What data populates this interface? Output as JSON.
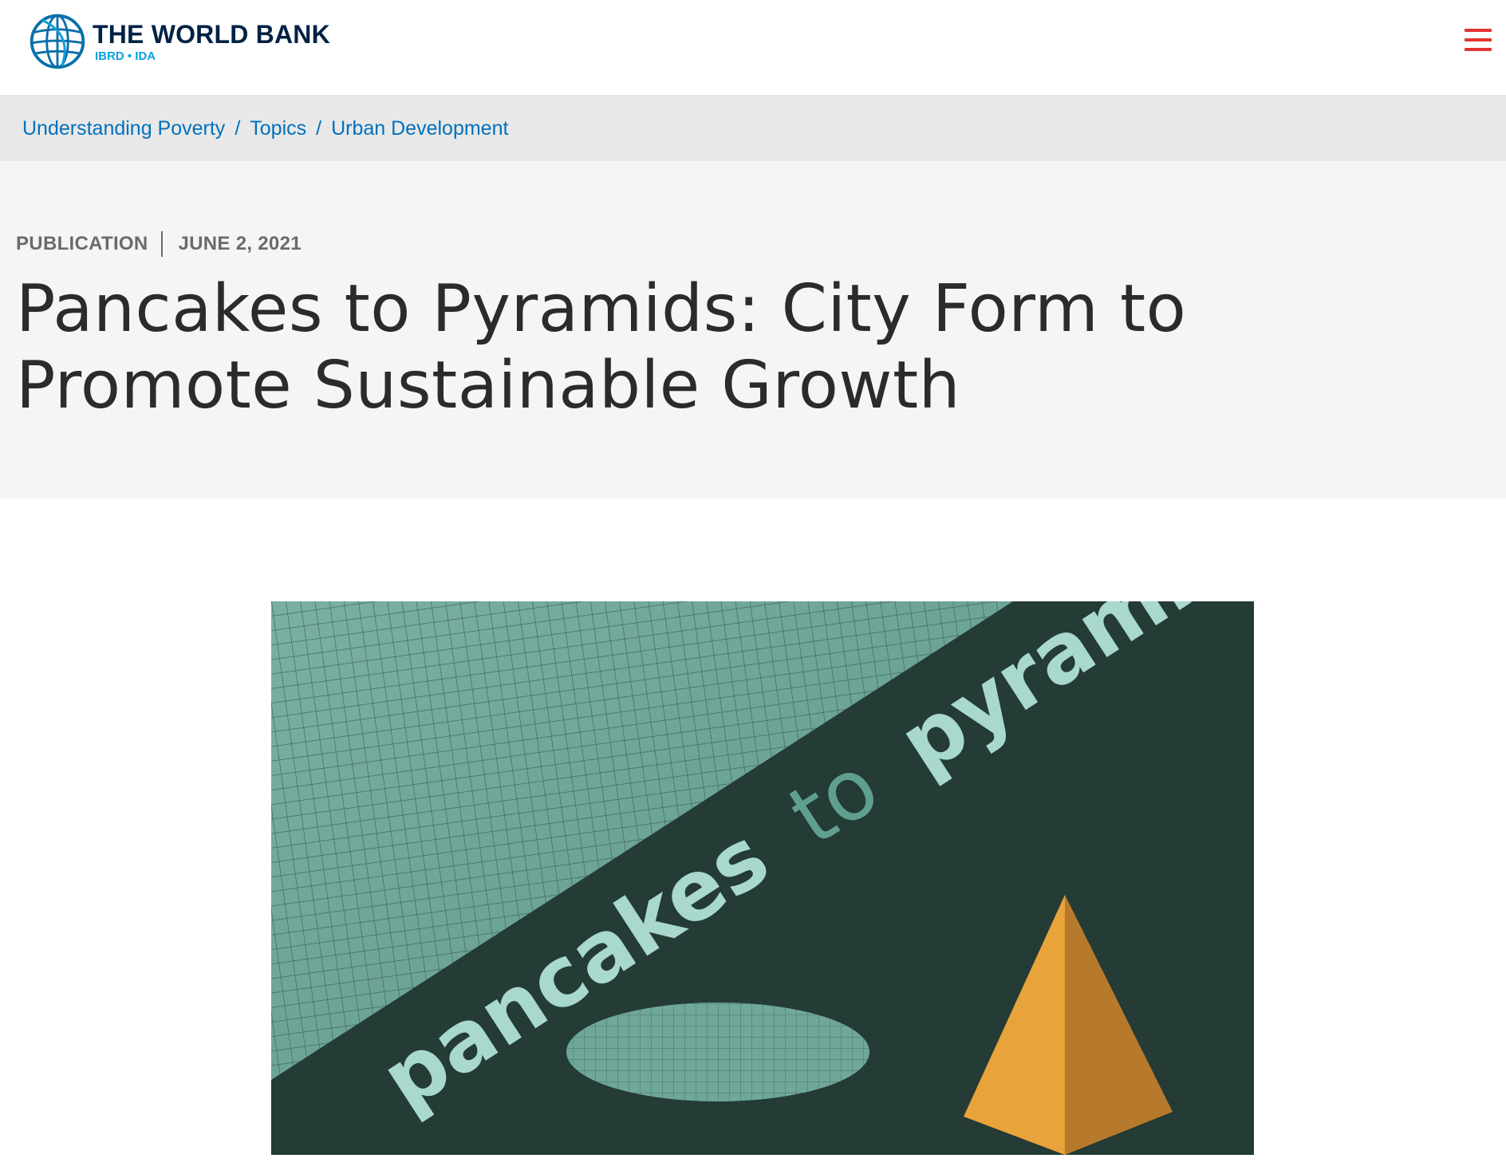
{
  "header": {
    "logo_title": "THE WORLD BANK",
    "logo_subtitle": "IBRD • IDA",
    "globe_icon": "world-bank-globe-icon",
    "menu_icon": "hamburger-menu-icon",
    "brand_color": "#002244",
    "accent_color": "#0aa1dd",
    "menu_color": "#e1342f"
  },
  "breadcrumb": {
    "items": [
      "Understanding Poverty",
      "Topics",
      "Urban Development"
    ],
    "separator": "/",
    "link_color": "#0071bc"
  },
  "article": {
    "type_label": "PUBLICATION",
    "date": "JUNE 2, 2021",
    "title": "Pancakes to Pyramids: City Form to Promote Sustainable Growth"
  },
  "feature_image": {
    "text_word1": "pancakes",
    "text_word2": "to",
    "text_word3": "pyramids",
    "colors": {
      "background": "#243b36",
      "mesh": "#6fa898",
      "word_light": "#a8d8ce",
      "word_to": "#5f9f8e",
      "pyramid": "#e8a33a"
    }
  }
}
